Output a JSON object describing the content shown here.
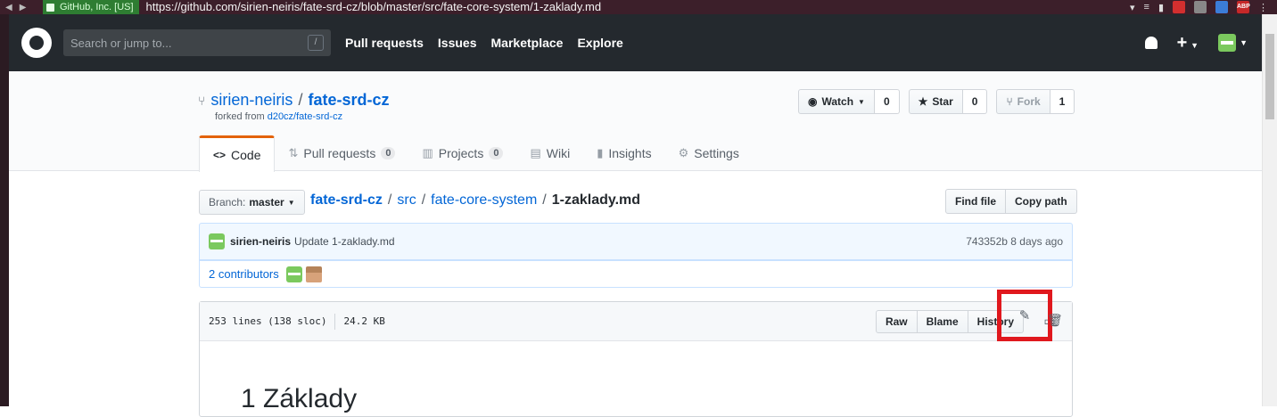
{
  "browser": {
    "secure_label": "GitHub, Inc. [US]",
    "url": "https://github.com/sirien-neiris/fate-srd-cz/blob/master/src/fate-core-system/1-zaklady.md",
    "ext_abp_label": "ABP"
  },
  "header": {
    "search_placeholder": "Search or jump to...",
    "search_hint": "/",
    "nav": [
      "Pull requests",
      "Issues",
      "Marketplace",
      "Explore"
    ],
    "plus": "+"
  },
  "repo": {
    "owner": "sirien-neiris",
    "separator": "/",
    "name": "fate-srd-cz",
    "forked_prefix": "forked from",
    "forked_source": "d20cz/fate-srd-cz",
    "watch_label": "Watch",
    "watch_count": "0",
    "star_label": "Star",
    "star_count": "0",
    "fork_label": "Fork",
    "fork_count": "1"
  },
  "tabs": [
    {
      "label": "Code",
      "icon": "code-icon"
    },
    {
      "label": "Pull requests",
      "count": "0",
      "icon": "pull-request-icon"
    },
    {
      "label": "Projects",
      "count": "0",
      "icon": "project-icon"
    },
    {
      "label": "Wiki",
      "icon": "book-icon"
    },
    {
      "label": "Insights",
      "icon": "graph-icon"
    },
    {
      "label": "Settings",
      "icon": "gear-icon"
    }
  ],
  "file_nav": {
    "branch_prefix": "Branch:",
    "branch": "master",
    "crumbs": [
      "fate-srd-cz",
      "src",
      "fate-core-system"
    ],
    "file": "1-zaklady.md",
    "find_file": "Find file",
    "copy_path": "Copy path"
  },
  "commit": {
    "author": "sirien-neiris",
    "message": "Update 1-zaklady.md",
    "sha": "743352b",
    "age": "8 days ago",
    "contributors": "2 contributors"
  },
  "file": {
    "lines": "253 lines (138 sloc)",
    "size": "24.2 KB",
    "raw": "Raw",
    "blame": "Blame",
    "history": "History",
    "heading": "1 Základy"
  },
  "colors": {
    "header_bg": "#24292e",
    "link": "#0366d6",
    "highlight": "#e0181e",
    "tab_accent": "#e36209"
  }
}
